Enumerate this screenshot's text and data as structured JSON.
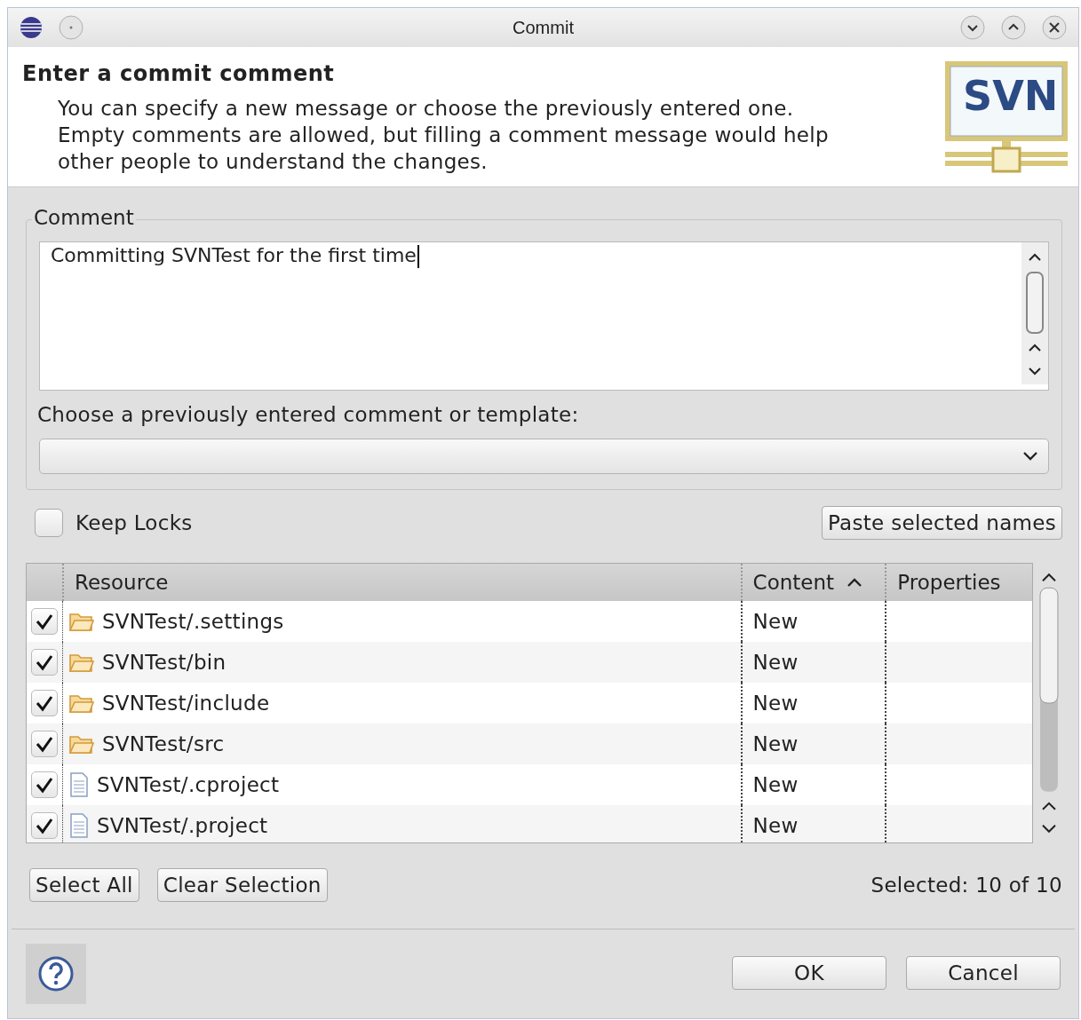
{
  "window": {
    "title": "Commit"
  },
  "header": {
    "title": "Enter a commit comment",
    "description": [
      "You can specify a new message or choose the previously entered one.",
      "Empty comments are allowed, but filling a comment message would help",
      "other people to understand the changes."
    ],
    "logo_text": "SVN"
  },
  "comment": {
    "group_label": "Comment",
    "value": "Committing SVNTest for the first time",
    "history_label": "Choose a previously entered comment or template:"
  },
  "keep_locks": {
    "label": "Keep Locks",
    "checked": false
  },
  "paste_button": {
    "label": "Paste selected names"
  },
  "table": {
    "columns": [
      {
        "label": "Resource",
        "sorted": false
      },
      {
        "label": "Content",
        "sorted": true
      },
      {
        "label": "Properties",
        "sorted": false
      }
    ],
    "rows": [
      {
        "kind": "folder",
        "resource": "SVNTest/.settings",
        "content": "New",
        "checked": true
      },
      {
        "kind": "folder",
        "resource": "SVNTest/bin",
        "content": "New",
        "checked": true
      },
      {
        "kind": "folder",
        "resource": "SVNTest/include",
        "content": "New",
        "checked": true
      },
      {
        "kind": "folder",
        "resource": "SVNTest/src",
        "content": "New",
        "checked": true
      },
      {
        "kind": "file",
        "resource": "SVNTest/.cproject",
        "content": "New",
        "checked": true
      },
      {
        "kind": "file",
        "resource": "SVNTest/.project",
        "content": "New",
        "checked": true
      }
    ]
  },
  "selection_buttons": [
    "Select All",
    "Clear Selection"
  ],
  "selected_count": "Selected: 10 of 10",
  "buttons": [
    "OK",
    "Cancel"
  ]
}
